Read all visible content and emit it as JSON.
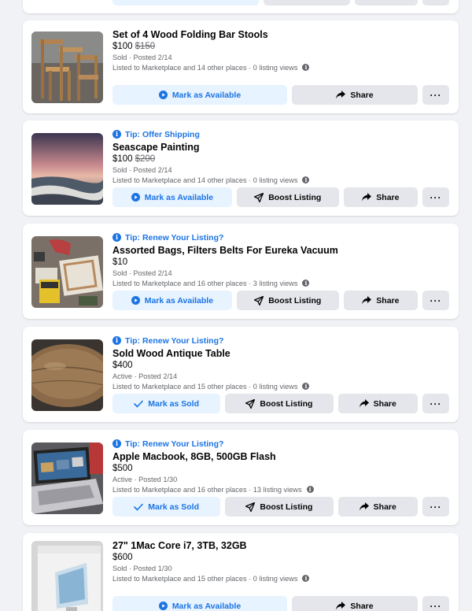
{
  "top_card": {
    "buttons": {
      "mark": "",
      "share": "",
      "more": "···"
    }
  },
  "listings": [
    {
      "tip": "",
      "title": "Set of 4 Wood Folding Bar Stools",
      "price": "$100",
      "old_price": "$150",
      "status": "Sold · Posted 2/14",
      "places": "Listed to Marketplace and 14 other places · 0 listing views",
      "mark_label": "Mark as Available",
      "boost_label": "",
      "share_label": "Share",
      "more_label": "···",
      "image_icon": "bar-stools-photo"
    },
    {
      "tip": "Tip: Offer Shipping",
      "title": "Seascape Painting",
      "price": "$100",
      "old_price": "$200",
      "status": "Sold · Posted 2/14",
      "places": "Listed to Marketplace and 14 other places · 0 listing views",
      "mark_label": "Mark as Available",
      "boost_label": "Boost Listing",
      "share_label": "Share",
      "more_label": "···",
      "image_icon": "seascape-photo"
    },
    {
      "tip": "Tip: Renew Your Listing?",
      "title": "Assorted Bags, Filters Belts For Eureka Vacuum",
      "price": "$10",
      "old_price": "",
      "status": "Sold · Posted 2/14",
      "places": "Listed to Marketplace and 16 other places · 3 listing views",
      "mark_label": "Mark as Available",
      "boost_label": "Boost Listing",
      "share_label": "Share",
      "more_label": "···",
      "image_icon": "vacuum-bags-photo"
    },
    {
      "tip": "Tip: Renew Your Listing?",
      "title": "Sold Wood Antique Table",
      "price": "$400",
      "old_price": "",
      "status": "Active · Posted 2/14",
      "places": "Listed to Marketplace and 15 other places · 0 listing views",
      "mark_label": "Mark as Sold",
      "boost_label": "Boost Listing",
      "share_label": "Share",
      "more_label": "···",
      "image_icon": "table-photo"
    },
    {
      "tip": "Tip: Renew Your Listing?",
      "title": "Apple Macbook, 8GB, 500GB Flash",
      "price": "$500",
      "old_price": "",
      "status": "Active · Posted 1/30",
      "places": "Listed to Marketplace and 16 other places · 13 listing views",
      "mark_label": "Mark as Sold",
      "boost_label": "Boost Listing",
      "share_label": "Share",
      "more_label": "···",
      "image_icon": "macbook-photo"
    },
    {
      "tip": "",
      "title": "27\" 1Mac Core i7, 3TB, 32GB",
      "price": "$600",
      "old_price": "",
      "status": "Sold · Posted 1/30",
      "places": "Listed to Marketplace and 15 other places · 0 listing views",
      "mark_label": "Mark as Available",
      "boost_label": "",
      "share_label": "Share",
      "more_label": "···",
      "image_icon": "imac-box-photo"
    }
  ],
  "colors": {
    "page_bg": "#f0f2f5",
    "accent": "#1b74e4",
    "primary_btn_bg": "#e7f3ff",
    "secondary_btn_bg": "#e4e6eb",
    "muted_text": "#65676b"
  }
}
